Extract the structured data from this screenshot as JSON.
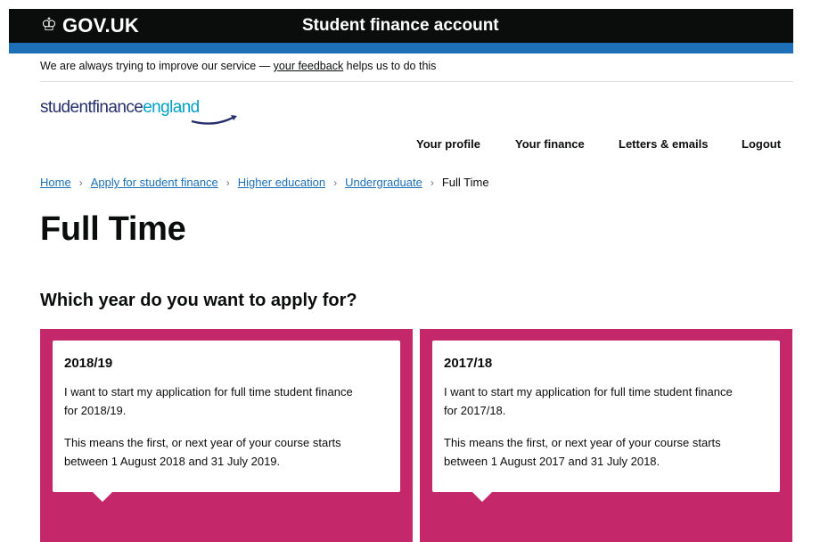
{
  "header": {
    "crown_icon": "crown-icon",
    "logo_text": "GOV.UK",
    "service_name": "Student finance account"
  },
  "phase_banner": {
    "before": "We are always trying to improve our service — ",
    "link": "your feedback",
    "after": " helps us to do this"
  },
  "brand": {
    "part1": "studentfinance",
    "part2": "england",
    "colors": {
      "dark": "#25306c",
      "light": "#00a0c6"
    }
  },
  "nav": {
    "items": [
      "Your profile",
      "Your finance",
      "Letters & emails",
      "Logout"
    ]
  },
  "breadcrumbs": {
    "links": [
      "Home",
      "Apply for student finance",
      "Higher education",
      "Undergraduate"
    ],
    "current": "Full Time",
    "separator": "›"
  },
  "page": {
    "title": "Full Time",
    "question": "Which year do you want to apply for?"
  },
  "options": [
    {
      "year": "2018/19",
      "line1": "I want to start my application for full time student finance for 2018/19.",
      "line2": "This means the first, or next year of your course starts between 1 August 2018 and 31 July 2019."
    },
    {
      "year": "2017/18",
      "line1": "I want to start my application for full time student finance for 2017/18.",
      "line2": "This means the first, or next year of your course starts between 1 August 2017 and 31 July 2018."
    }
  ],
  "colors": {
    "header_bg": "#0b0c0c",
    "accent_blue": "#1d70b8",
    "panel_pink": "#c4286a"
  }
}
